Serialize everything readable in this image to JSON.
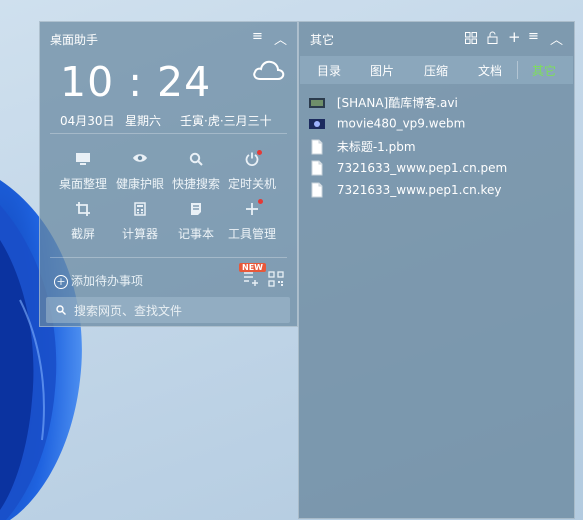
{
  "left_panel": {
    "title": "桌面助手",
    "clock": "10 : 24",
    "date": "04月30日",
    "weekday": "星期六",
    "lunar": "壬寅·虎·三月三十",
    "tools": [
      {
        "label": "桌面整理",
        "icon": "monitor-icon"
      },
      {
        "label": "健康护眼",
        "icon": "eye-icon"
      },
      {
        "label": "快捷搜索",
        "icon": "search-icon"
      },
      {
        "label": "定时关机",
        "icon": "power-icon"
      },
      {
        "label": "截屏",
        "icon": "crop-icon"
      },
      {
        "label": "计算器",
        "icon": "calculator-icon"
      },
      {
        "label": "记事本",
        "icon": "notepad-icon"
      },
      {
        "label": "工具管理",
        "icon": "plus-icon"
      }
    ],
    "todo_label": "添加待办事项",
    "new_badge": "NEW",
    "search_placeholder": "搜索网页、查找文件"
  },
  "right_panel": {
    "title": "其它",
    "tabs": [
      "目录",
      "图片",
      "压缩",
      "文档",
      "其它"
    ],
    "active_tab": "其它",
    "files": [
      {
        "name": "[SHANA]酷库博客.avi",
        "icon": "video-file-icon"
      },
      {
        "name": "movie480_vp9.webm",
        "icon": "video-file-icon"
      },
      {
        "name": "未标题-1.pbm",
        "icon": "blank-file-icon"
      },
      {
        "name": "7321633_www.pep1.cn.pem",
        "icon": "blank-file-icon"
      },
      {
        "name": "7321633_www.pep1.cn.key",
        "icon": "blank-file-icon"
      }
    ]
  },
  "colors": {
    "active_tab": "#7ddf5a",
    "notification_dot": "#e53935",
    "new_badge": "#e8583a"
  }
}
